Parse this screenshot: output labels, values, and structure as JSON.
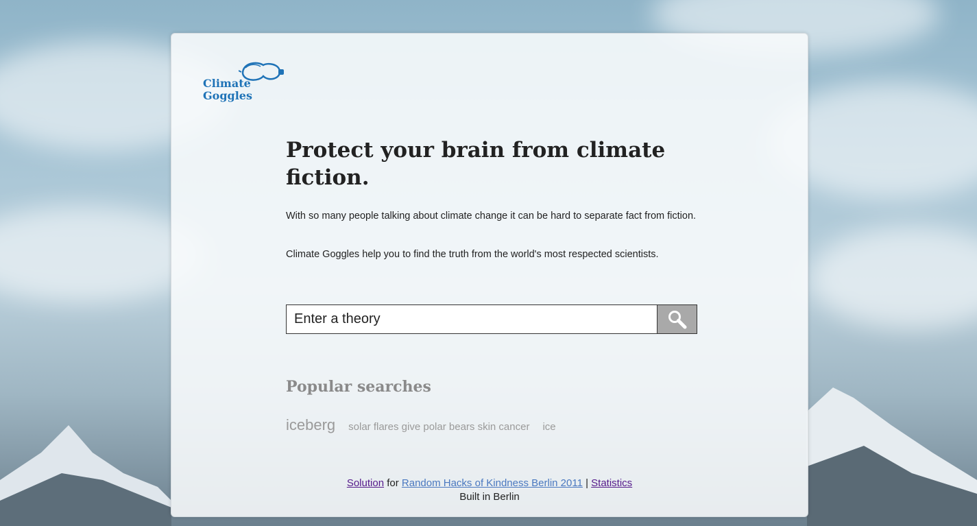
{
  "logo": {
    "line1": "Climate",
    "line2": "Goggles"
  },
  "headline": "Protect your brain from climate fiction.",
  "intro": {
    "paragraph1": "With so many people talking about climate change it can be hard to separate fact from fiction.",
    "paragraph2": "Climate Goggles help you to find the truth from the world's most respected scientists."
  },
  "search": {
    "placeholder": "Enter a theory",
    "button_icon": "search-icon"
  },
  "popular": {
    "title": "Popular searches",
    "items": [
      "iceberg",
      "solar flares give polar bears skin cancer",
      "ice"
    ]
  },
  "footer": {
    "solution_link": "Solution",
    "for_text": " for ",
    "event_link": "Random Hacks of Kindness Berlin 2011",
    "separator": " | ",
    "stats_link": "Statistics",
    "built": "Built in Berlin"
  },
  "colors": {
    "logo_blue": "#1f73b7",
    "button_gray": "#a9a9a9",
    "visited_link": "#551a8b",
    "blue_link": "#4a78c0"
  }
}
